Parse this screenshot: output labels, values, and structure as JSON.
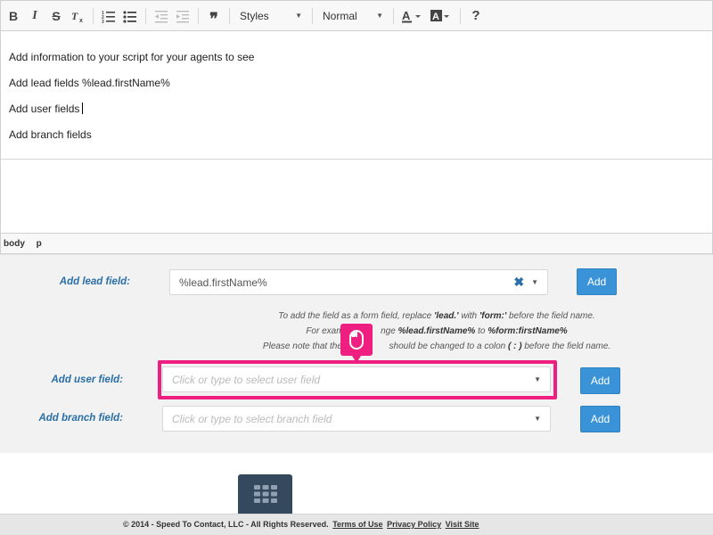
{
  "toolbar": {
    "styles_label": "Styles",
    "format_label": "Normal"
  },
  "editor": {
    "lines": [
      "Add information to your script for your agents to see",
      "Add lead fields %lead.firstName%",
      "Add user fields",
      "Add branch fields"
    ]
  },
  "pathbar": [
    "body",
    "p"
  ],
  "form": {
    "lead": {
      "label": "Add lead field:",
      "value": "%lead.firstName%",
      "button": "Add"
    },
    "note": {
      "line1_a": "To add the field as a form field, replace ",
      "line1_b": "'lead.'",
      "line1_c": " with ",
      "line1_d": "'form:'",
      "line1_e": " before the field name.",
      "line2_a": "For examp",
      "line2_b": "nge ",
      "line2_c": "%lead.firstName%",
      "line2_d": " to ",
      "line2_e": "%form:firstName%",
      "line3_a": "Please note that the pe",
      "line3_b": " should be changed to a colon ",
      "line3_c": "( : )",
      "line3_d": " before the field name."
    },
    "user": {
      "label": "Add user field:",
      "placeholder": "Click or type to select user field",
      "button": "Add"
    },
    "branch": {
      "label": "Add branch field:",
      "placeholder": "Click or type to select branch field",
      "button": "Add"
    }
  },
  "footer": {
    "copyright": "© 2014 - Speed To Contact, LLC - All Rights Reserved.",
    "terms": "Terms of Use",
    "privacy": "Privacy Policy",
    "visit": "Visit Site"
  },
  "colors": {
    "accent": "#3a93d6",
    "label": "#2a6fa8",
    "highlight": "#ee1f80",
    "grid_button": "#34495e"
  }
}
